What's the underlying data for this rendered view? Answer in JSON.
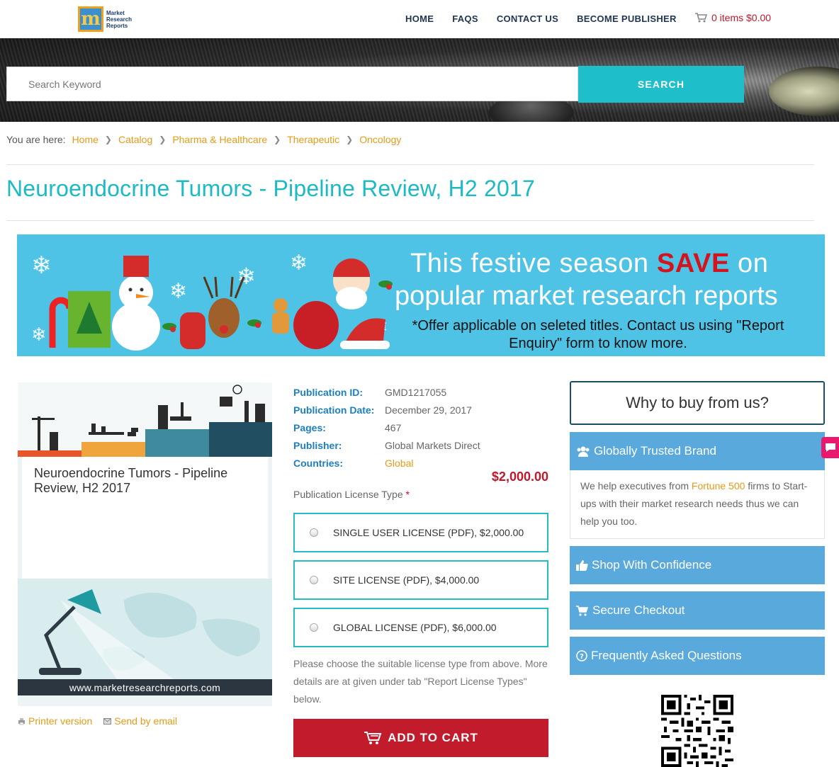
{
  "header": {
    "logo_lines": [
      "Market",
      "Research",
      "Reports"
    ],
    "logo_letter": "m",
    "nav": [
      "HOME",
      "FAQS",
      "CONTACT US",
      "BECOME PUBLISHER"
    ],
    "cart_text": "0 items $0.00"
  },
  "search": {
    "placeholder": "Search Keyword",
    "button": "SEARCH"
  },
  "breadcrumb": {
    "lead": "You are here:",
    "items": [
      "Home",
      "Catalog",
      "Pharma & Healthcare",
      "Therapeutic",
      "Oncology"
    ]
  },
  "page_title": "Neuroendocrine Tumors - Pipeline Review, H2 2017",
  "promo": {
    "line1_pre": "This festive season ",
    "line1_save": "SAVE",
    "line1_post": " on",
    "line2": "popular market research reports",
    "line3": "*Offer applicable on seleted titles. Contact us using \"Report Enquiry\" form to know more."
  },
  "product_image": {
    "title": "Neuroendocrine Tumors - Pipeline Review, H2 2017",
    "url": "www.marketresearchreports.com"
  },
  "tools": {
    "printer": "Printer version",
    "email": "Send by email"
  },
  "meta": {
    "rows": [
      {
        "label": "Publication ID:",
        "value": "GMD1217055"
      },
      {
        "label": "Publication Date:",
        "value": "December 29, 2017"
      },
      {
        "label": "Pages:",
        "value": "467"
      },
      {
        "label": "Publisher:",
        "value": "Global Markets Direct"
      },
      {
        "label": "Countries:",
        "value": "Global"
      }
    ],
    "price": "$2,000.00"
  },
  "license": {
    "label": "Publication License Type",
    "required_mark": "*",
    "options": [
      "SINGLE USER LICENSE (PDF), $2,000.00",
      "SITE LICENSE (PDF), $4,000.00",
      "GLOBAL LICENSE (PDF), $6,000.00"
    ],
    "note": "Please choose the suitable license type from above. More details are at given under tab \"Report License Types\" below.",
    "add_to_cart": "ADD TO CART"
  },
  "sidebar": {
    "why_title": "Why to buy from us?",
    "trusted": "Globally Trusted Brand",
    "trusted_body_pre": "We help executives from ",
    "trusted_body_hl": "Fortune 500",
    "trusted_body_post": " firms to Start-ups with their market research needs thus we can help you too.",
    "confidence": "Shop With Confidence",
    "checkout": "Secure Checkout",
    "faq": "Frequently Asked Questions"
  },
  "colors": {
    "accent_teal": "#1ebfcb",
    "title_teal": "#1bbac4",
    "link_orange": "#e89a16",
    "price_red": "#c0182c",
    "sidebar_blue": "#5aa9dd",
    "promo_blue": "#4fc3e6"
  }
}
